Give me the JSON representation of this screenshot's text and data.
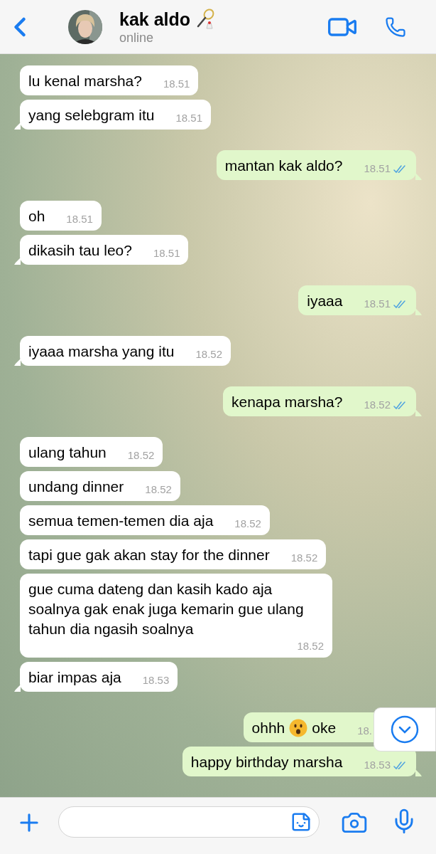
{
  "contact": {
    "name": "kak aldo",
    "status": "online"
  },
  "messages": [
    {
      "kind": "incoming",
      "text": "lu kenal marsha?",
      "time": "18.51"
    },
    {
      "kind": "incoming",
      "text": "yang selebgram itu",
      "time": "18.51"
    },
    {
      "kind": "outgoing",
      "text": "mantan kak aldo?",
      "time": "18.51",
      "read": true
    },
    {
      "kind": "incoming",
      "text": "oh",
      "time": "18.51"
    },
    {
      "kind": "incoming",
      "text": "dikasih tau leo?",
      "time": "18.51"
    },
    {
      "kind": "outgoing",
      "text": "iyaaa",
      "time": "18.51",
      "read": true
    },
    {
      "kind": "incoming",
      "text": "iyaaa marsha yang itu",
      "time": "18.52"
    },
    {
      "kind": "outgoing",
      "text": "kenapa marsha?",
      "time": "18.52",
      "read": true
    },
    {
      "kind": "incoming",
      "text": "ulang tahun",
      "time": "18.52"
    },
    {
      "kind": "incoming",
      "text": "undang dinner",
      "time": "18.52"
    },
    {
      "kind": "incoming",
      "text": "semua temen-temen dia aja",
      "time": "18.52"
    },
    {
      "kind": "incoming",
      "text": "tapi gue gak akan stay for the dinner",
      "time": "18.52"
    },
    {
      "kind": "incoming",
      "text": "gue cuma dateng dan kasih kado aja soalnya gak enak juga kemarin gue ulang tahun dia ngasih soalnya",
      "time": "18.52"
    },
    {
      "kind": "incoming",
      "text": "biar impas aja",
      "time": "18.53"
    },
    {
      "kind": "outgoing",
      "parts": [
        "ohhh",
        "oke"
      ],
      "time": "18."
    },
    {
      "kind": "outgoing",
      "text": "happy birthday marsha",
      "time": "18.53",
      "read": true
    }
  ]
}
